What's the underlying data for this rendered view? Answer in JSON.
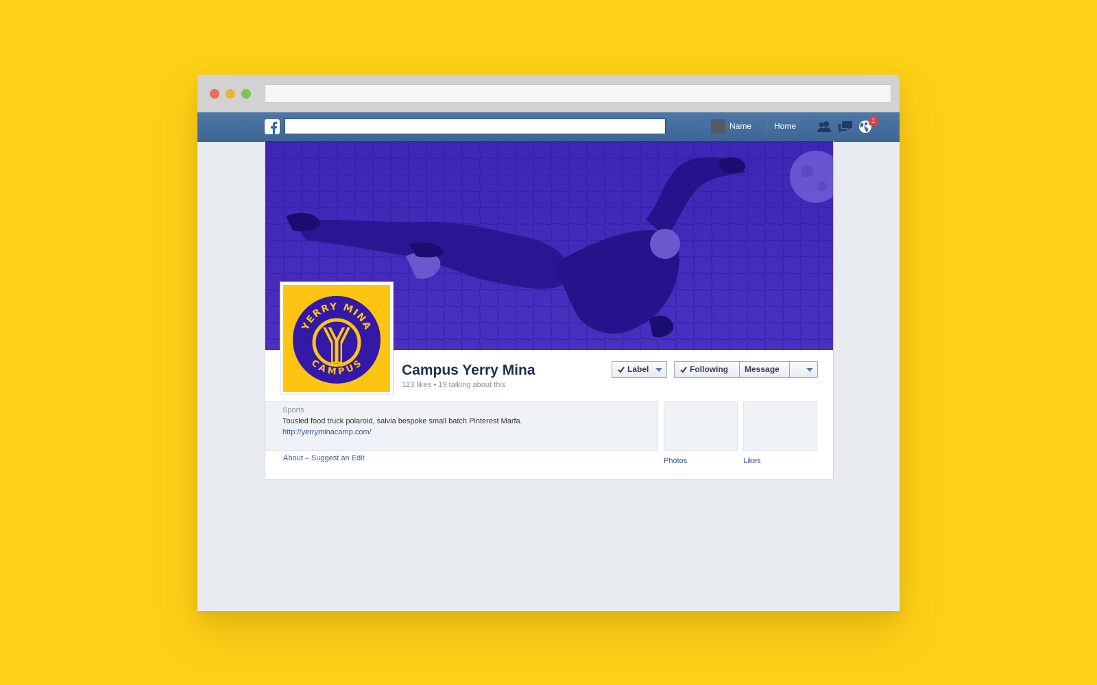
{
  "browser": {
    "address": ""
  },
  "fb_nav": {
    "search_value": "",
    "user_name": "Name",
    "home_label": "Home",
    "notification_count": "1",
    "icons": [
      "friends-icon",
      "messages-icon",
      "globe-notifications-icon"
    ]
  },
  "page": {
    "title": "Campus Yerry Mina",
    "stats": "123 likes • 19 talking about this",
    "logo_text_top": "YERRY MINA",
    "logo_text_bottom": "CAMPUS",
    "buttons": {
      "label": "Label",
      "following": "Following",
      "message": "Message"
    },
    "about": {
      "category": "Sports",
      "description": "Tousled food truck polaroid, salvia bespoke small batch Pinterest Marfa.",
      "link": "http://yerryminacamp.com/",
      "edit_link": "About – Suggest an Edit"
    },
    "thumbs": {
      "photos": "Photos",
      "likes": "Likes"
    }
  },
  "colors": {
    "background": "#fdd117",
    "fb_blue": "#3e6695",
    "cover_tint": "#3d22b6",
    "logo_yellow": "#fdc512",
    "logo_blue": "#3418a8"
  }
}
